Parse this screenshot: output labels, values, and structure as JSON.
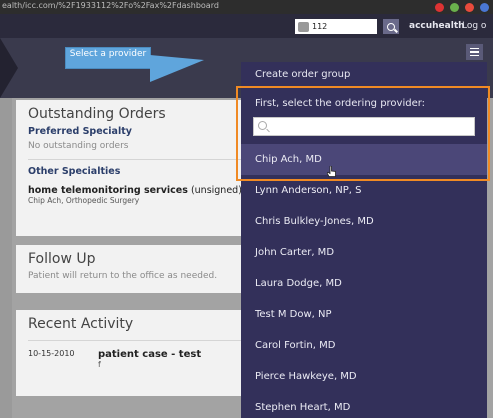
{
  "browser": {
    "url": "ealth/icc.com/%2F1933112%2Fo%2Fax%2Fdashboard"
  },
  "header": {
    "patient_id": "112",
    "username": "accuhealth",
    "logout_label": "Log o"
  },
  "callout": {
    "text": "Select a provider"
  },
  "cards": {
    "outstanding": {
      "title": "Outstanding Orders",
      "preferred_label": "Preferred Specialty",
      "preferred_empty": "No outstanding orders",
      "other_label": "Other Specialties",
      "service_bold": "home telemonitoring services",
      "service_status": " (unsigned)",
      "service_sub": "Chip Ach, Orthopedic Surgery"
    },
    "followup": {
      "title": "Follow Up",
      "text": "Patient will return to the office as needed."
    },
    "activity": {
      "title": "Recent Activity",
      "rows": [
        {
          "date": "10-15-2010",
          "title": "patient case - test",
          "sub": "f"
        }
      ]
    }
  },
  "dropdown": {
    "create_label": "Create order group",
    "prompt": "First, select the ordering provider:",
    "search_placeholder": "",
    "providers": [
      "Chip Ach, MD",
      "Lynn Anderson, NP, S",
      "Chris Bulkley-Jones, MD",
      "John Carter, MD",
      "Laura Dodge, MD",
      "Test M Dow, NP",
      "Carol Fortin, MD",
      "Pierce Hawkeye, MD",
      "Stephen Heart, MD"
    ],
    "selected_index": 0
  },
  "colors": {
    "header_bg": "#2b2a3c",
    "dropdown_bg": "#33305a",
    "highlight": "#f08a24",
    "callout": "#5fa5dc"
  }
}
